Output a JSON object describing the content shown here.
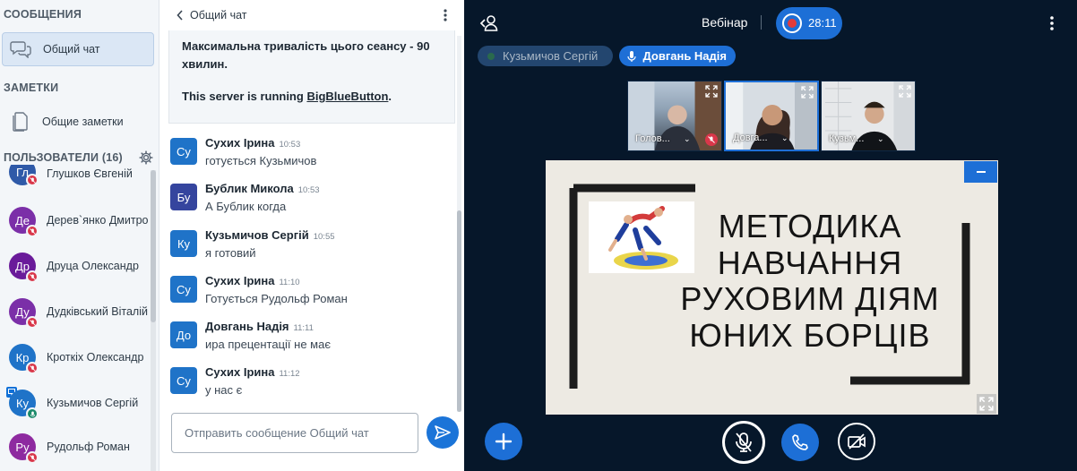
{
  "sidebar": {
    "messages_title": "СООБЩЕНИЯ",
    "public_chat_label": "Общий чат",
    "notes_title": "ЗАМЕТКИ",
    "shared_notes_label": "Общие заметки",
    "users_title": "ПОЛЬЗОВАТЕЛИ (16)",
    "users": [
      {
        "initials": "Гл",
        "name": "Глушков Євгеній",
        "color": "#2f5aa8"
      },
      {
        "initials": "Де",
        "name": "Дерев`янко Дмитро",
        "color": "#7b2fa8"
      },
      {
        "initials": "Др",
        "name": "Друца Олександр",
        "color": "#6a1b9a"
      },
      {
        "initials": "Ду",
        "name": "Дудківський Віталій",
        "color": "#7b2fa8"
      },
      {
        "initials": "Кр",
        "name": "Кроткіх Олександр",
        "color": "#1f73c8"
      },
      {
        "initials": "Ку",
        "name": "Кузьмичов Сергій",
        "color": "#1f73c8"
      },
      {
        "initials": "Ру",
        "name": "Рудольф Роман",
        "color": "#8e2aa0"
      }
    ]
  },
  "chat": {
    "title": "Общий чат",
    "welcome_line1": "Максимальна тривалість цього сеансу - 90 хвилин.",
    "welcome_line2_prefix": "This server is running ",
    "welcome_link": "BigBlueButton",
    "welcome_line2_suffix": ".",
    "messages": [
      {
        "initials": "Су",
        "name": "Сухих Ірина",
        "time": "10:53",
        "text": "готується Кузьмичов",
        "color": "#1f73c8"
      },
      {
        "initials": "Бу",
        "name": "Бублик Микола",
        "time": "10:53",
        "text": "А Бублик когда",
        "color": "#35459e"
      },
      {
        "initials": "Ку",
        "name": "Кузьмичов Сергій",
        "time": "10:55",
        "text": "я готовий",
        "color": "#1f73c8"
      },
      {
        "initials": "Су",
        "name": "Сухих Ірина",
        "time": "11:10",
        "text": "Готується Рудольф Роман",
        "color": "#1f73c8"
      },
      {
        "initials": "До",
        "name": "Довгань Надія",
        "time": "11:11",
        "text": "ира прецентації не має",
        "color": "#1f73c8"
      },
      {
        "initials": "Су",
        "name": "Сухих Ірина",
        "time": "11:12",
        "text": "у нас є",
        "color": "#1f73c8"
      }
    ],
    "input_placeholder": "Отправить сообщение Общий чат"
  },
  "main": {
    "session_title": "Вебінар",
    "recording_time": "28:11",
    "talkers": [
      {
        "name": "Кузьмичов Сергій",
        "active": false
      },
      {
        "name": "Довгань Надія",
        "active": true
      }
    ],
    "videos": [
      {
        "name": "Голов...",
        "muted": true
      },
      {
        "name": "Довга...",
        "muted": false
      },
      {
        "name": "Кузьм...",
        "muted": false
      }
    ],
    "slide_lines": [
      "МЕТОДИКА",
      "НАВЧАННЯ",
      "РУХОВИМ ДІЯМ",
      "ЮНИХ БОРЦІВ"
    ]
  },
  "colors": {
    "accent": "#1d6fd6",
    "background": "#06172a",
    "muted_badge": "#d9374a"
  }
}
